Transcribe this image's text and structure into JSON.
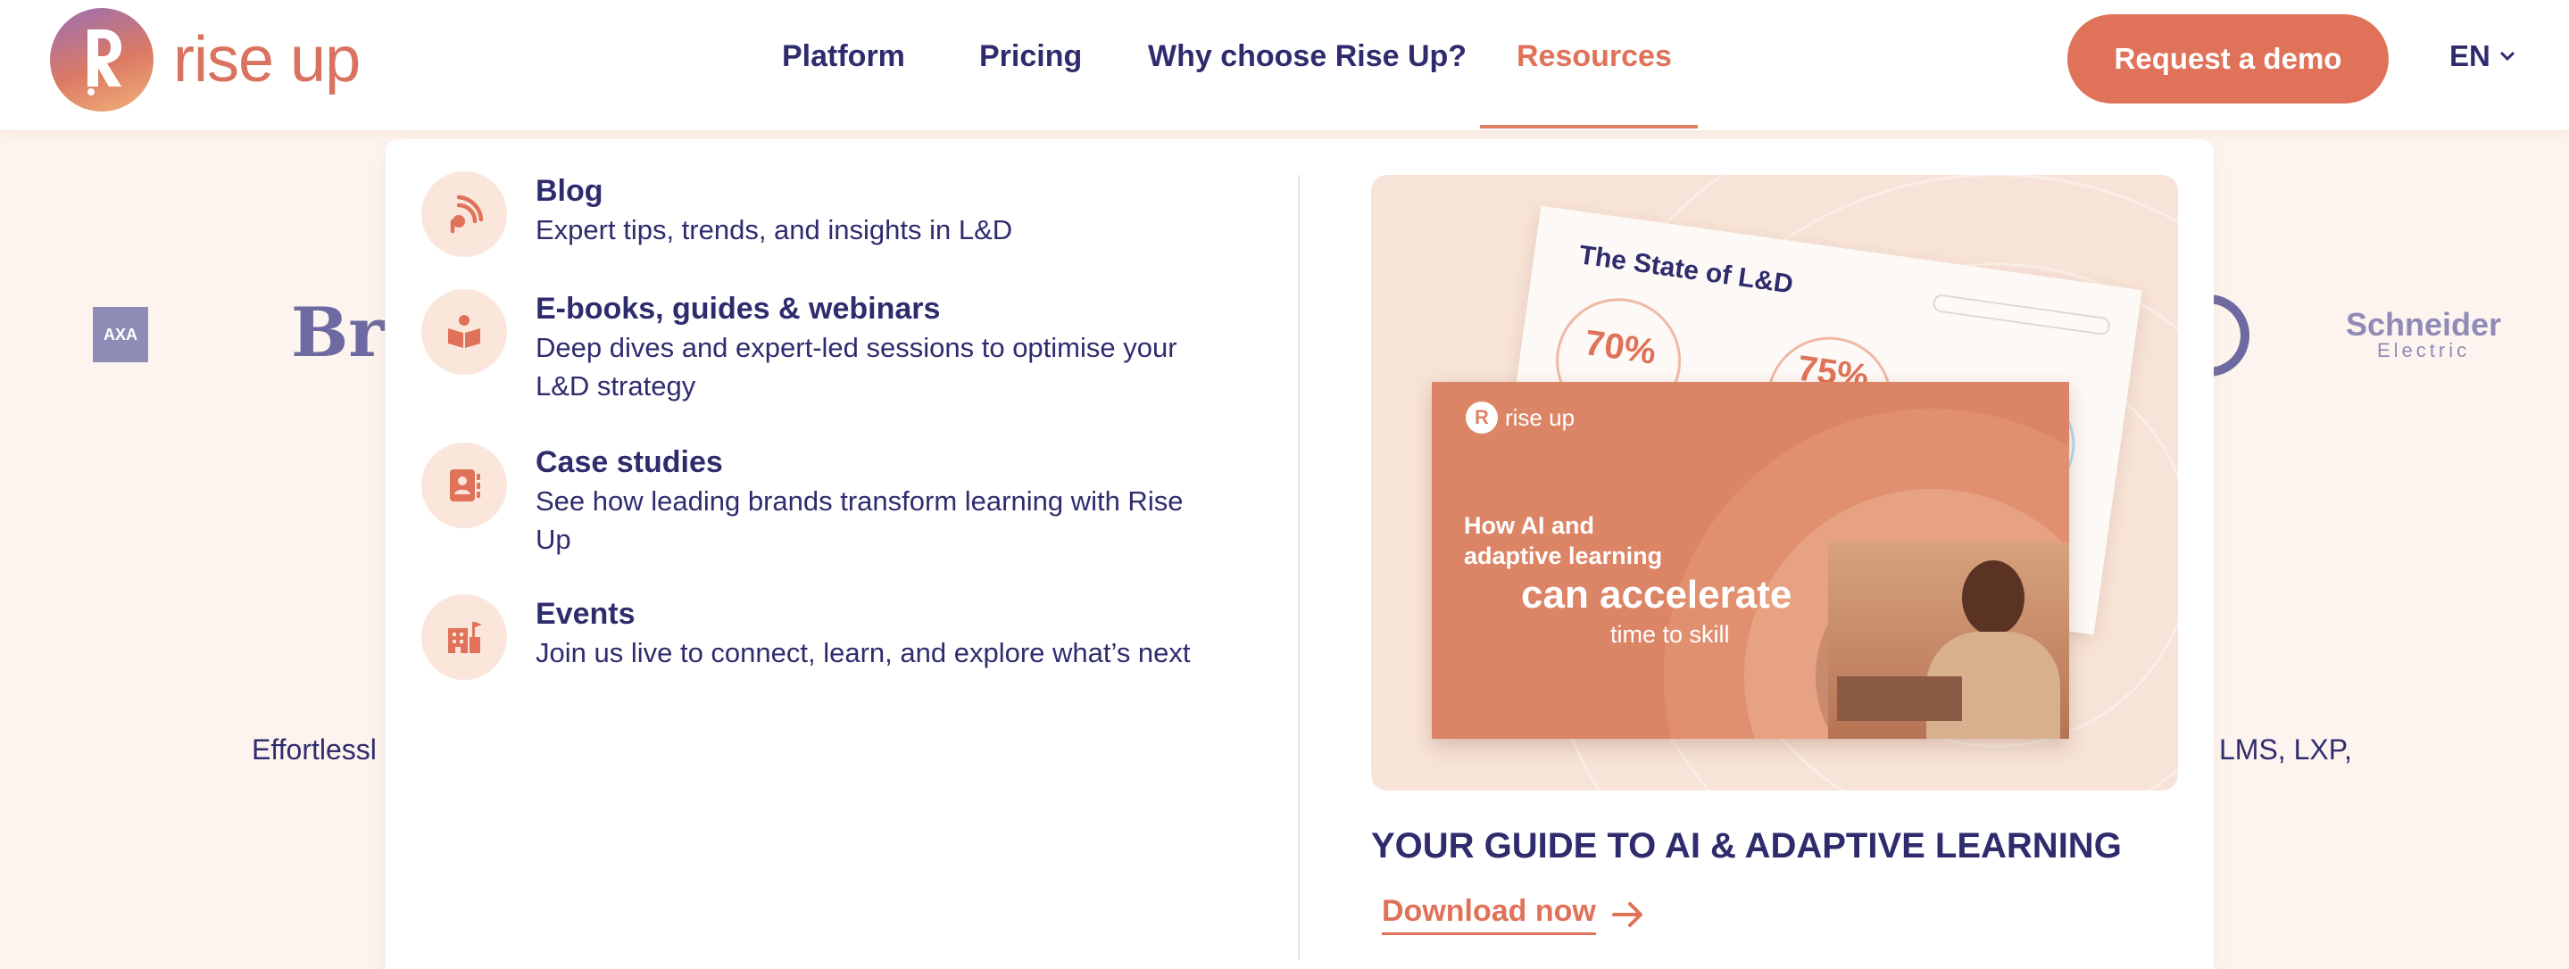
{
  "brand": {
    "name": "rise up",
    "accent": "#df7258",
    "navy": "#2f2c6e"
  },
  "nav": {
    "items": [
      {
        "label": "Platform"
      },
      {
        "label": "Pricing"
      },
      {
        "label": "Why choose Rise Up?"
      },
      {
        "label": "Resources",
        "active": true
      }
    ],
    "cta_label": "Request a demo",
    "language": "EN"
  },
  "background": {
    "logos": [
      "AXA",
      "Bra",
      "Schneider",
      "Electric"
    ],
    "text_left": "Effortlessl",
    "text_right": "LMS, LXP,"
  },
  "resources_menu": {
    "items": [
      {
        "title": "Blog",
        "description": "Expert tips, trends, and insights in L&D",
        "icon": "broadcast-icon"
      },
      {
        "title": "E-books, guides & webinars",
        "description": "Deep dives and expert-led sessions to optimise your L&D strategy",
        "icon": "book-reader-icon"
      },
      {
        "title": "Case studies",
        "description": "See how leading brands transform learning with Rise Up",
        "icon": "contact-book-icon"
      },
      {
        "title": "Events",
        "description": "Join us live to connect, learn, and explore what’s next",
        "icon": "building-flag-icon"
      }
    ],
    "promo": {
      "report_title": "The State of L&D",
      "stat_1": "70%",
      "stat_2": "75%",
      "cover_brand": "rise up",
      "cover_line_1": "How AI and",
      "cover_line_2": "adaptive learning",
      "cover_line_3": "can accelerate",
      "cover_line_4": "time to skill",
      "heading": "YOUR GUIDE TO AI & ADAPTIVE LEARNING",
      "link_label": "Download now"
    }
  }
}
